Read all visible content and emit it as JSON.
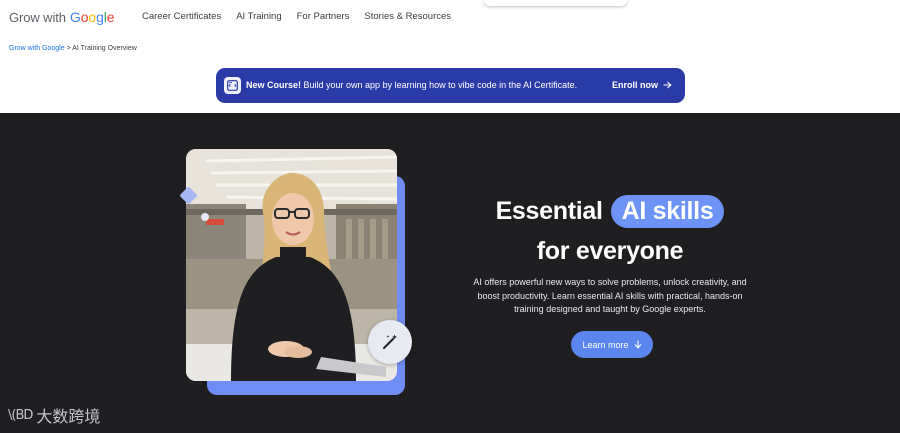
{
  "header": {
    "logo_prefix": "Grow with",
    "logo_brand_letters": [
      "G",
      "o",
      "o",
      "g",
      "l",
      "e"
    ],
    "logo_brand_colors": [
      "#4285F4",
      "#EA4335",
      "#FBBC05",
      "#4285F4",
      "#34A853",
      "#EA4335"
    ],
    "nav": [
      "Career Certificates",
      "AI Training",
      "For Partners",
      "Stories & Resources"
    ]
  },
  "breadcrumb": {
    "link": "Grow with Google",
    "separator": " > ",
    "current": "AI Training Overview"
  },
  "promo": {
    "icon": "code-app-icon",
    "bold": "New Course!",
    "text": " Build your own app by learning how to vibe code in the AI Certificate.",
    "cta": "Enroll now",
    "cta_icon": "arrow-right-icon"
  },
  "hero": {
    "title_part1": "Essential",
    "title_highlight": "AI skills",
    "title_line2": "for everyone",
    "description": "AI offers powerful new ways to solve problems, unlock creativity, and boost productivity. Learn essential AI skills with practical, hands-on training designed and taught by Google experts.",
    "button": "Learn more",
    "button_icon": "arrow-down-icon",
    "badge_icon": "magic-wand-icon"
  },
  "watermark": {
    "mark": "\\(BD",
    "text": "大数跨境"
  },
  "colors": {
    "hero_bg": "#1f1f21",
    "promo_bg": "#2a3ba8",
    "accent": "#6d93f7",
    "button": "#5b86ee"
  }
}
